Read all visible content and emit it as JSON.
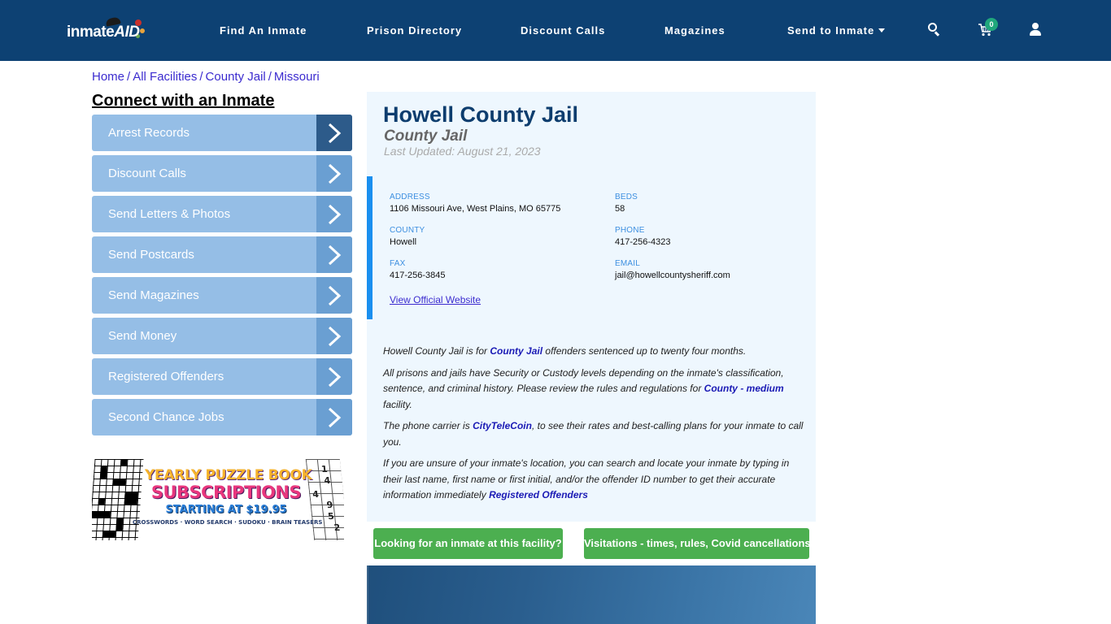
{
  "header": {
    "logo_text_main": "inmate",
    "logo_text_accent": "AID",
    "nav": [
      {
        "label": "Find An Inmate"
      },
      {
        "label": "Prison Directory"
      },
      {
        "label": "Discount Calls"
      },
      {
        "label": "Magazines"
      },
      {
        "label": "Send to Inmate",
        "has_dropdown": true
      }
    ],
    "icons": [
      "search-icon",
      "cart-icon",
      "user-icon"
    ],
    "cart_count": "0"
  },
  "breadcrumb": [
    {
      "label": "Home"
    },
    {
      "label": "All Facilities"
    },
    {
      "label": "County Jail"
    },
    {
      "label": "Missouri"
    }
  ],
  "sidebar": {
    "title": "Connect with an Inmate",
    "items": [
      {
        "label": "Arrest Records",
        "active": true
      },
      {
        "label": "Discount Calls"
      },
      {
        "label": "Send Letters & Photos"
      },
      {
        "label": "Send Postcards"
      },
      {
        "label": "Send Magazines"
      },
      {
        "label": "Send Money"
      },
      {
        "label": "Registered Offenders"
      },
      {
        "label": "Second Chance Jobs"
      }
    ],
    "ad": {
      "line1": "YEARLY PUZZLE BOOK",
      "line2": "SUBSCRIPTIONS",
      "line3": "STARTING AT $19.95",
      "line4": "CROSSWORDS · WORD SEARCH · SUDOKU · BRAIN TEASERS",
      "sudoku_digits": [
        "1",
        "4",
        "4",
        "9",
        "5",
        "2"
      ]
    }
  },
  "facility": {
    "name": "Howell County Jail",
    "type": "County Jail",
    "last_updated": "Last Updated: August 21, 2023",
    "info": {
      "address_label": "ADDRESS",
      "address": "1106 Missouri Ave, West Plains, MO 65775",
      "beds_label": "BEDS",
      "beds": "58",
      "county_label": "COUNTY",
      "county": "Howell",
      "phone_label": "PHONE",
      "phone": "417-256-4323",
      "fax_label": "FAX",
      "fax": "417-256-3845",
      "email_label": "EMAIL",
      "email": "jail@howellcountysheriff.com",
      "website_link": "View Official Website"
    },
    "description": {
      "p1_pre": "Howell County Jail is for ",
      "p1_link": "County Jail",
      "p1_post": " offenders sentenced up to twenty four months.",
      "p2_pre": "All prisons and jails have Security or Custody levels depending on the inmate's classification, sentence, and criminal history. Please review the rules and regulations for ",
      "p2_link": "County - medium",
      "p2_post": " facility.",
      "p3_pre": "The phone carrier is ",
      "p3_link": "CityTeleCoin",
      "p3_post": ", to see their rates and best-calling plans for your inmate to call you.",
      "p4_pre": "If you are unsure of your inmate's location, you can search and locate your inmate by typing in their last name, first name or first initial, and/or the offender ID number to get their accurate information immediately ",
      "p4_link": "Registered Offenders"
    },
    "buttons": {
      "looking": "Looking for an inmate at this facility?",
      "visitations": "Visitations - times, rules, Covid cancellations"
    }
  },
  "colors": {
    "header_bg": "#0d4173",
    "sidebar_item": "#95bee6",
    "sidebar_arrow": "#6a9fd2",
    "sidebar_arrow_active": "#2d5b8a",
    "card_bg": "#eef7fe",
    "accent_bar": "#1a8fef",
    "button_green": "#4caf50",
    "title_blue": "#0d3d6e",
    "link_blue": "#1b1bb5"
  }
}
